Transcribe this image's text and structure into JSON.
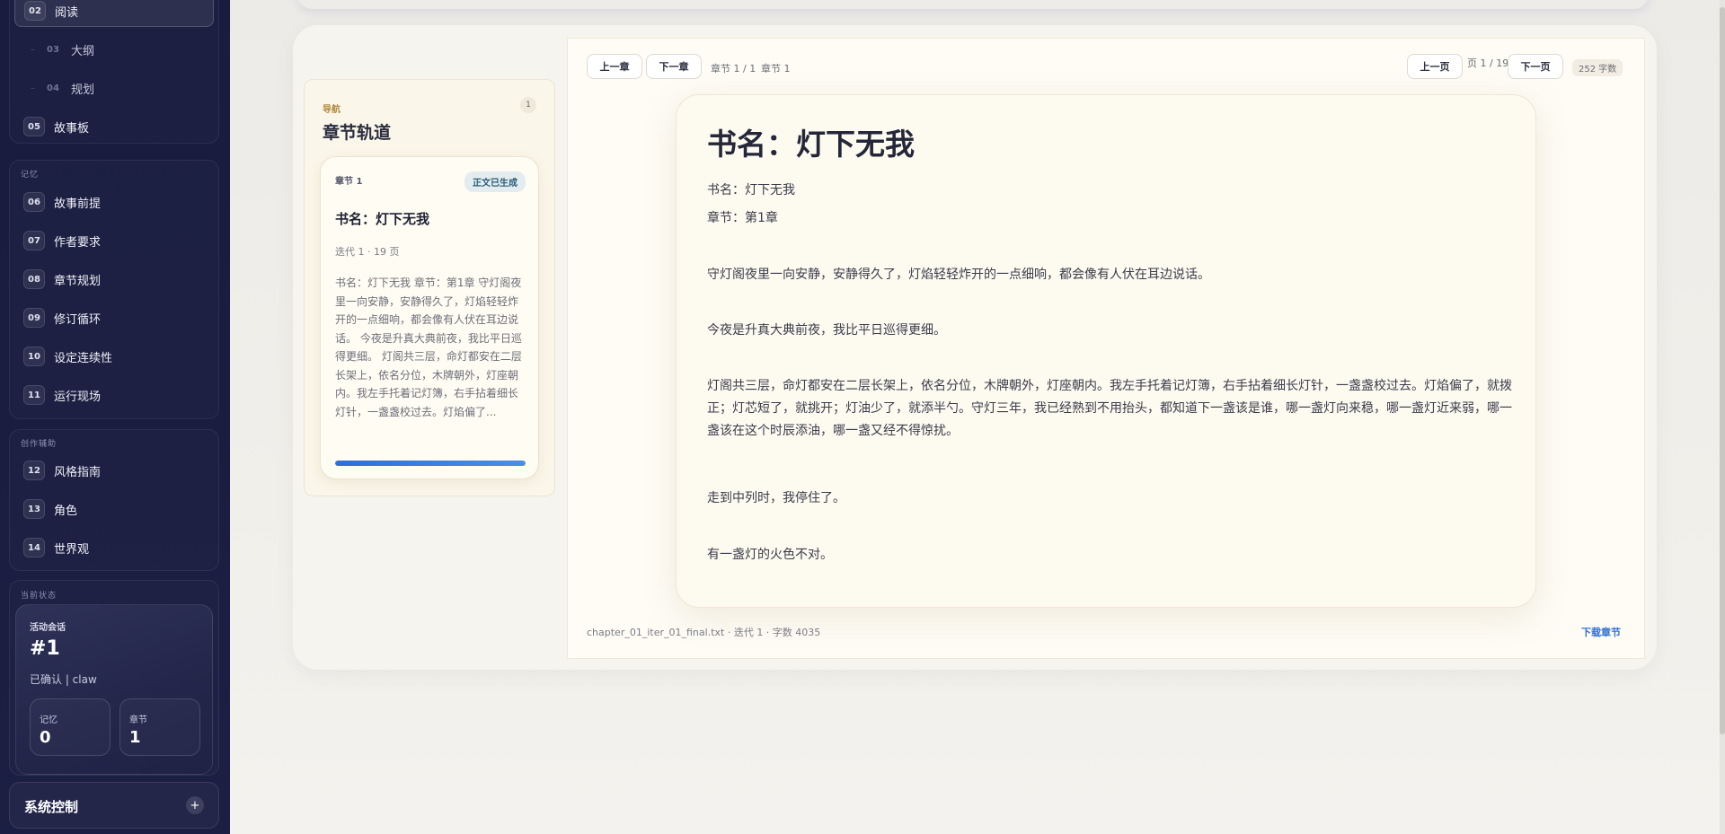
{
  "sidebar": {
    "top_items": [
      {
        "num": "02",
        "label": "阅读"
      },
      {
        "num": "03",
        "label": "大纲"
      },
      {
        "num": "04",
        "label": "规划"
      },
      {
        "num": "05",
        "label": "故事板"
      }
    ],
    "memory_group": {
      "title": "记忆",
      "items": [
        {
          "num": "06",
          "label": "故事前提"
        },
        {
          "num": "07",
          "label": "作者要求"
        },
        {
          "num": "08",
          "label": "章节规划"
        },
        {
          "num": "09",
          "label": "修订循环"
        },
        {
          "num": "10",
          "label": "设定连续性"
        },
        {
          "num": "11",
          "label": "运行现场"
        }
      ]
    },
    "assist_group": {
      "title": "创作辅助",
      "items": [
        {
          "num": "12",
          "label": "风格指南"
        },
        {
          "num": "13",
          "label": "角色"
        },
        {
          "num": "14",
          "label": "世界观"
        }
      ]
    },
    "status": {
      "title": "当前状态",
      "session_label": "活动会话",
      "session_id": "#1",
      "confirm_text": "已确认 | claw",
      "memory_label": "记忆",
      "memory_value": "0",
      "chapter_label": "章节",
      "chapter_value": "1"
    },
    "system": {
      "label": "系统控制",
      "add_symbol": "+"
    }
  },
  "track": {
    "kicker": "导航",
    "title": "章节轨道",
    "count": "1",
    "card": {
      "chapter": "章节 1",
      "badge": "正文已生成",
      "title": "书名：灯下无我",
      "meta": "迭代 1 · 19 页",
      "excerpt": "书名：灯下无我 章节：第1章 守灯阁夜里一向安静，安静得久了，灯焰轻轻炸开的一点细响，都会像有人伏在耳边说话。 今夜是升真大典前夜，我比平日巡得更细。 灯阁共三层，命灯都安在二层长架上，依名分位，木牌朝外，灯座朝内。我左手托着记灯簿，右手拈着细长灯针，一盏盏校过去。灯焰偏了...",
      "progress": 1.0
    }
  },
  "reader": {
    "prev_chapter": "上一章",
    "next_chapter": "下一章",
    "chapter_position": "章节 1 / 1",
    "chapter_name": "章节 1",
    "prev_page": "上一页",
    "page_indicator": "页 1 / 19",
    "next_page": "下一页",
    "word_count": "252 字数",
    "page_title": "书名：灯下无我",
    "paragraphs": [
      "书名：灯下无我",
      "章节：第1章",
      "守灯阁夜里一向安静，安静得久了，灯焰轻轻炸开的一点细响，都会像有人伏在耳边说话。",
      "今夜是升真大典前夜，我比平日巡得更细。",
      "灯阁共三层，命灯都安在二层长架上，依名分位，木牌朝外，灯座朝内。我左手托着记灯簿，右手拈着细长灯针，一盏盏校过去。灯焰偏了，就拨正；灯芯短了，就挑开；灯油少了，就添半勺。守灯三年，我已经熟到不用抬头，都知道下一盏该是谁，哪一盏灯向来稳，哪一盏灯近来弱，哪一盏该在这个时辰添油，哪一盏又经不得惊扰。",
      "走到中列时，我停住了。",
      "有一盏灯的火色不对。"
    ],
    "file_info": "chapter_01_iter_01_final.txt · 迭代 1 · 字数 4035",
    "download": "下载章节"
  },
  "colors": {
    "sidebar_bg": "#1a1d40",
    "accent_blue": "#2f6fd6",
    "kicker_gold": "#b08a3e",
    "badge_bg": "#e3ecef"
  }
}
